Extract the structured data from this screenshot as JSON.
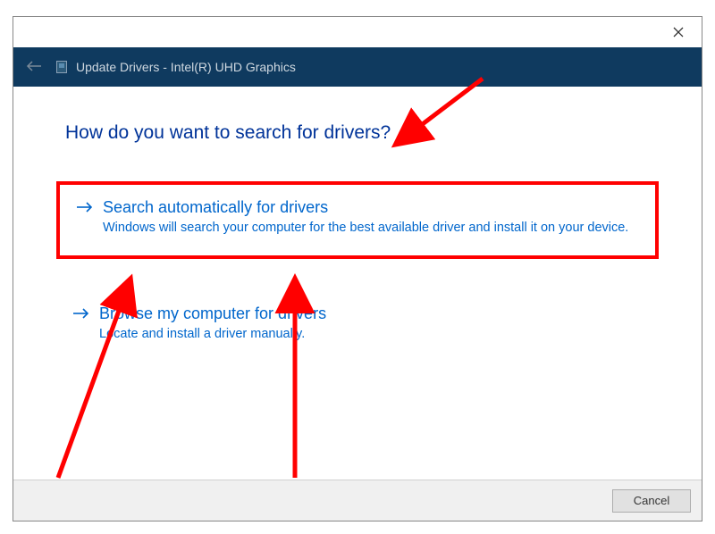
{
  "titlebar": {
    "title": "Update Drivers - Intel(R) UHD Graphics"
  },
  "heading": "How do you want to search for drivers?",
  "options": [
    {
      "title": "Search automatically for drivers",
      "desc": "Windows will search your computer for the best available driver and install it on your device."
    },
    {
      "title": "Browse my computer for drivers",
      "desc": "Locate and install a driver manually."
    }
  ],
  "buttons": {
    "cancel": "Cancel"
  }
}
